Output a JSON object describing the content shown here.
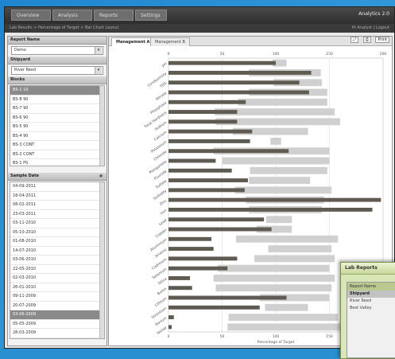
{
  "window": {
    "tabs": [
      "Overview",
      "Analysis",
      "Reports",
      "Settings"
    ],
    "brand": "Analytics 2.0",
    "breadcrumb": "Lab Results > Percentage of Target > Bar Chart Layout",
    "user": "Hi Analyst | Logout"
  },
  "sidebar": {
    "report_label": "Report Name",
    "report_value": "Demo",
    "shipyard_label": "Shipyard",
    "shipyard_value": "River Reed",
    "blocks_label": "Blocks",
    "blocks": [
      "BS-1 10",
      "BS-8 90",
      "BS-7 90",
      "BS-6 90",
      "BS-5 90",
      "BS-4 90",
      "BS-3 CONT",
      "BS-2 CONT",
      "BS-1 PS"
    ],
    "blocks_selected": 0,
    "sample_label": "Sample Date",
    "sample_dates": [
      "04-09-2011",
      "18-04-2011",
      "08-02-2011",
      "23-03-2011",
      "03-11-2010",
      "05-10-2010",
      "01-08-2010",
      "14-07-2010",
      "03-06-2010",
      "22-05-2010",
      "02-03-2010",
      "26-01-2010",
      "09-11-2009",
      "20-07-2009",
      "03-06-2009",
      "05-05-2009",
      "28-03-2009"
    ],
    "sample_selected": 14
  },
  "main": {
    "tabs": [
      "Management A",
      "Management B"
    ],
    "tools": [
      "⤢",
      "⎙",
      "Print"
    ]
  },
  "chart_data": {
    "type": "bar",
    "xlabel": "Percentage of Target",
    "xlim": [
      0,
      200
    ],
    "xticks": [
      0,
      50,
      100,
      150,
      200
    ],
    "categories": [
      "pH",
      "Conductivity",
      "TDS",
      "Nitrate",
      "Phosphate",
      "Total Hardness",
      "Sodium",
      "Calcium",
      "Potassium",
      "Chloride",
      "Manganese",
      "Fluoride",
      "Sulfate",
      "Turbidity",
      "Zinc",
      "Iron",
      "Lead",
      "Copper",
      "Aluminium",
      "Arsenic",
      "Cadmium",
      "Selenium",
      "Silica",
      "Boron",
      "Lithium",
      "Strontium",
      "Barium",
      "Nickel"
    ],
    "series": [
      {
        "values": [
          100,
          133,
          122,
          131,
          72,
          64,
          64,
          78,
          76,
          112,
          44,
          59,
          74,
          71,
          198,
          190,
          89,
          96,
          40,
          42,
          64,
          55,
          20,
          22,
          110,
          85,
          5,
          3
        ]
      },
      {
        "values": [
          [
            97,
            110
          ],
          [
            75,
            142
          ],
          [
            98,
            143
          ],
          [
            75,
            148
          ],
          [
            65,
            148
          ],
          [
            43,
            155
          ],
          [
            44,
            160
          ],
          [
            60,
            130
          ],
          [
            95,
            105
          ],
          [
            42,
            150
          ],
          [
            50,
            150
          ],
          [
            76,
            148
          ],
          [
            75,
            132
          ],
          [
            62,
            152
          ],
          [
            72,
            145
          ],
          [
            75,
            143
          ],
          [
            91,
            115
          ],
          [
            82,
            115
          ],
          [
            63,
            158
          ],
          [
            93,
            152
          ],
          [
            80,
            155
          ],
          [
            46,
            150
          ],
          [
            42,
            155
          ],
          [
            44,
            152
          ],
          [
            85,
            150
          ],
          [
            90,
            130
          ],
          [
            56,
            158
          ],
          [
            55,
            160
          ]
        ]
      }
    ]
  },
  "popup": {
    "title": "Lab Reports",
    "header": "Report Name",
    "selected": "Shipyard",
    "rows": [
      "River Reed",
      "Best Valley"
    ]
  }
}
